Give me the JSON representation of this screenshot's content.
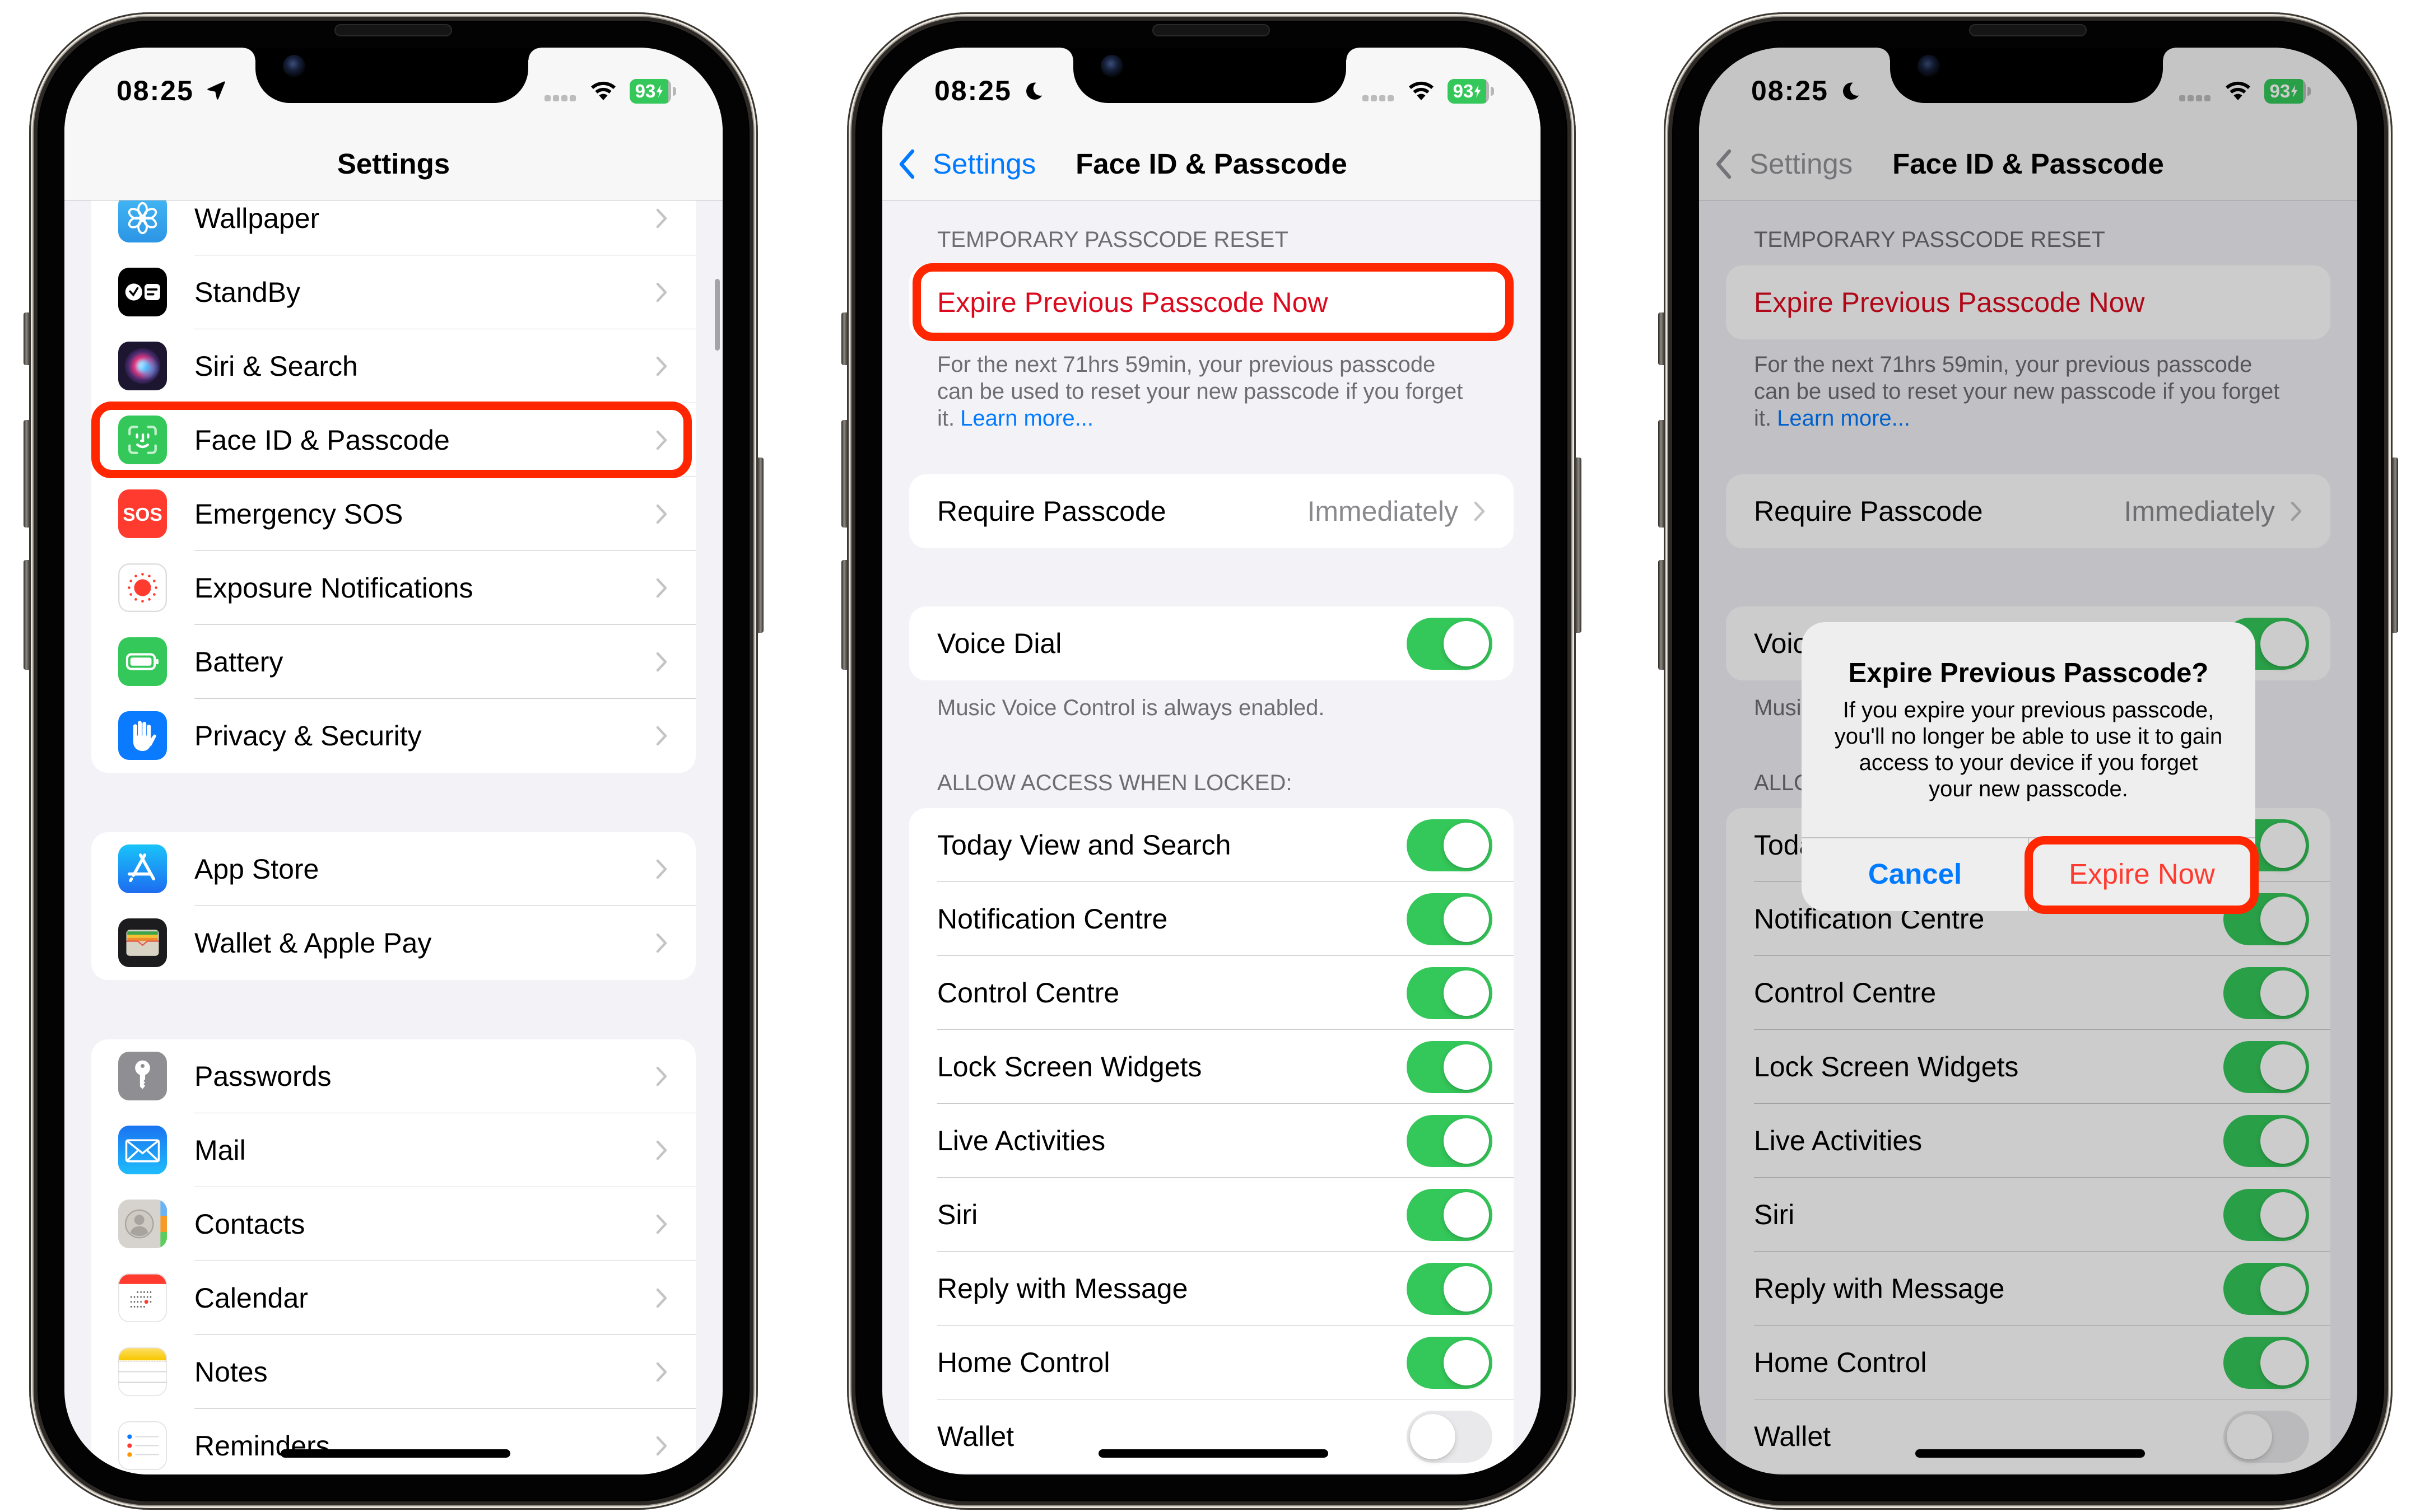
{
  "colors": {
    "accent_blue": "#007aff",
    "destructive_red": "#dc0a1e",
    "alert_destructive_red": "#ff3b30",
    "toggle_green": "#34c759",
    "annotation_red": "#ff2600",
    "secondary_text": "#6d6d72"
  },
  "phone_1": {
    "status": {
      "time": "08:25",
      "activity_icon": "location-arrow-icon",
      "battery_level": 93,
      "charging": true
    },
    "nav": {
      "title": "Settings"
    },
    "groups": [
      [
        {
          "label": "Wallpaper",
          "icon": "wallpaper-icon"
        },
        {
          "label": "StandBy",
          "icon": "standby-icon"
        },
        {
          "label": "Siri & Search",
          "icon": "siri-icon"
        },
        {
          "label": "Face ID & Passcode",
          "icon": "face-id-icon"
        },
        {
          "label": "Emergency SOS",
          "icon": "emergency-sos-icon",
          "icon_text": "SOS"
        },
        {
          "label": "Exposure Notifications",
          "icon": "exposure-notifications-icon"
        },
        {
          "label": "Battery",
          "icon": "battery-icon"
        },
        {
          "label": "Privacy & Security",
          "icon": "privacy-hand-icon"
        }
      ],
      [
        {
          "label": "App Store",
          "icon": "app-store-icon"
        },
        {
          "label": "Wallet & Apple Pay",
          "icon": "wallet-icon"
        }
      ],
      [
        {
          "label": "Passwords",
          "icon": "passwords-key-icon"
        },
        {
          "label": "Mail",
          "icon": "mail-icon"
        },
        {
          "label": "Contacts",
          "icon": "contacts-icon"
        },
        {
          "label": "Calendar",
          "icon": "calendar-icon"
        },
        {
          "label": "Notes",
          "icon": "notes-icon"
        },
        {
          "label": "Reminders",
          "icon": "reminders-icon"
        }
      ]
    ]
  },
  "phone_2": {
    "status": {
      "time": "08:25",
      "activity_icon": "moon-focus-icon",
      "battery_level": 93,
      "charging": true
    },
    "nav": {
      "back_label": "Settings",
      "title": "Face ID & Passcode"
    },
    "temp_reset": {
      "header": "TEMPORARY PASSCODE RESET",
      "action": "Expire Previous Passcode Now",
      "description_lines": [
        "For the next 71hrs 59min, your previous passcode",
        "can be used to reset your new passcode if you forget",
        "it."
      ],
      "learn_more": "Learn more..."
    },
    "require_passcode": {
      "label": "Require Passcode",
      "value": "Immediately"
    },
    "voice_dial": {
      "label": "Voice Dial",
      "on": true,
      "footer": "Music Voice Control is always enabled."
    },
    "locked_access": {
      "header": "ALLOW ACCESS WHEN LOCKED:",
      "items": [
        {
          "label": "Today View and Search",
          "on": true
        },
        {
          "label": "Notification Centre",
          "on": true
        },
        {
          "label": "Control Centre",
          "on": true
        },
        {
          "label": "Lock Screen Widgets",
          "on": true
        },
        {
          "label": "Live Activities",
          "on": true
        },
        {
          "label": "Siri",
          "on": true
        },
        {
          "label": "Reply with Message",
          "on": true
        },
        {
          "label": "Home Control",
          "on": true
        },
        {
          "label": "Wallet",
          "on": false
        }
      ]
    }
  },
  "phone_3": {
    "status": {
      "time": "08:25",
      "activity_icon": "moon-focus-icon",
      "battery_level": 93,
      "charging": true
    },
    "nav": {
      "back_label": "Settings",
      "title": "Face ID & Passcode"
    },
    "temp_reset": {
      "header": "TEMPORARY PASSCODE RESET",
      "action": "Expire Previous Passcode Now",
      "description_lines": [
        "For the next 71hrs 59min, your previous passcode",
        "can be used to reset your new passcode if you forget",
        "it."
      ],
      "learn_more": "Learn more..."
    },
    "require_passcode": {
      "label": "Require Passcode",
      "value": "Immediately"
    },
    "voice_dial": {
      "label": "Voice Dial",
      "on": true,
      "footer": "Music Voice Control is always enabled."
    },
    "locked_access": {
      "header": "ALLOW ACCESS WHEN LOCKED:",
      "items": [
        {
          "label": "Today View and Search",
          "on": true
        },
        {
          "label": "Notification Centre",
          "on": true
        },
        {
          "label": "Control Centre",
          "on": true
        },
        {
          "label": "Lock Screen Widgets",
          "on": true
        },
        {
          "label": "Live Activities",
          "on": true
        },
        {
          "label": "Siri",
          "on": true
        },
        {
          "label": "Reply with Message",
          "on": true
        },
        {
          "label": "Home Control",
          "on": true
        },
        {
          "label": "Wallet",
          "on": false
        }
      ]
    },
    "alert": {
      "title": "Expire Previous Passcode?",
      "message_lines": [
        "If you expire your previous passcode,",
        "you'll no longer be able to use it to gain",
        "access to your device if you forget",
        "your new passcode."
      ],
      "cancel": "Cancel",
      "confirm": "Expire Now"
    }
  }
}
